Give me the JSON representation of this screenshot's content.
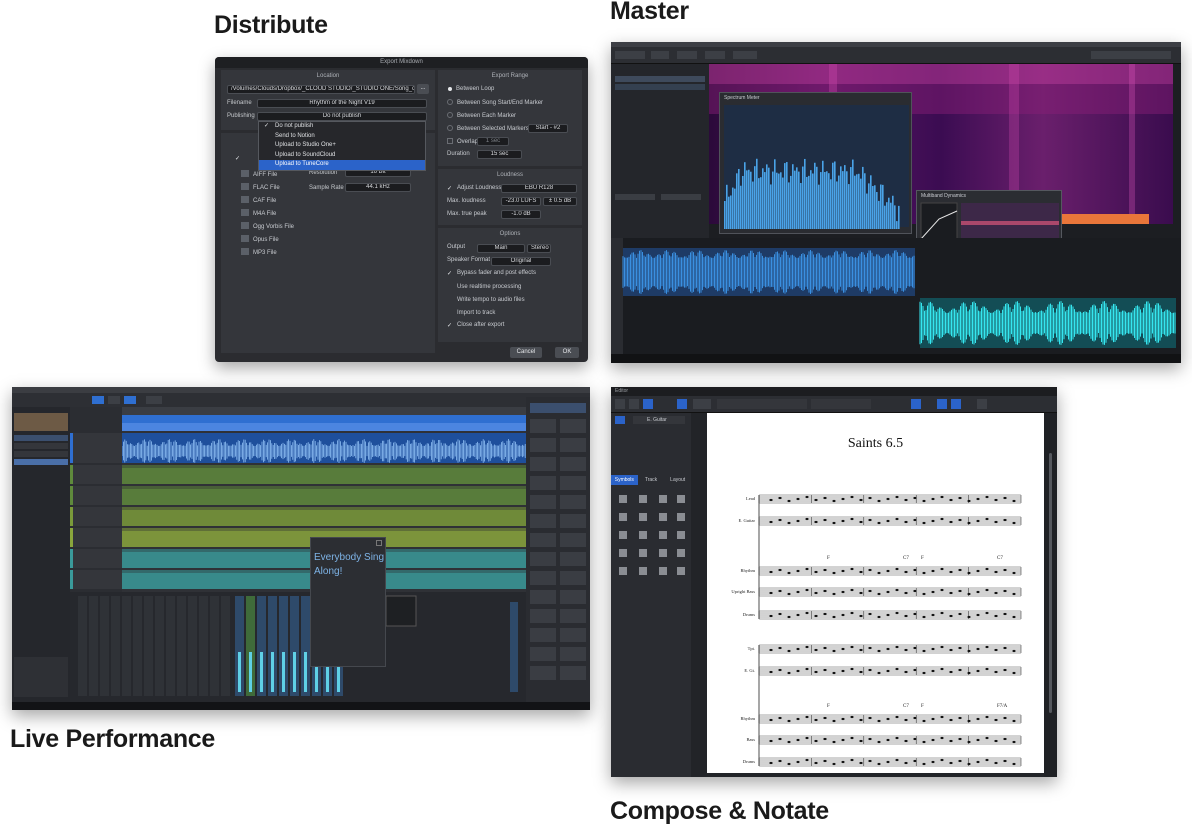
{
  "captions": {
    "distribute": "Distribute",
    "master": "Master",
    "live": "Live Performance",
    "compose": "Compose & Notate"
  },
  "export_mixdown": {
    "window_title": "Export Mixdown",
    "location_header": "Location",
    "path": "/Volumes/Clouds/Dropbox/_CLOUD STUDIO/_STUDIO ONE/Song_down",
    "path_button": "...",
    "filename_label": "Filename",
    "filename": "Rhythm of the Night V19",
    "publishing_label": "Publishing",
    "publishing_value": "Do not publish",
    "publish_options": [
      "Do not publish",
      "Send to Notion",
      "Upload to Studio One+",
      "Upload to SoundCloud",
      "Upload to TuneCore"
    ],
    "formats": [
      "AIFF File",
      "FLAC File",
      "CAF File",
      "M4A File",
      "Ogg Vorbis File",
      "Opus File",
      "MP3 File"
    ],
    "resolution_label": "Resolution",
    "resolution_value": "16 Bit",
    "samplerate_label": "Sample Rate",
    "samplerate_value": "44.1 kHz",
    "export_range_header": "Export Range",
    "range_options": [
      "Between Loop",
      "Between Song Start/End Marker",
      "Between Each Marker",
      "Between Selected Markers"
    ],
    "selected_marker_value": "Start - #2",
    "overlap_label": "Overlap",
    "overlap_value": "1 sec",
    "duration_label": "Duration",
    "duration_value": "15 sec",
    "loudness_header": "Loudness",
    "adjust_loudness_label": "Adjust Loudness",
    "adjust_loudness_value": "EBU R128",
    "max_loudness_label": "Max. loudness",
    "max_loudness_value": "-23.0 LUFS",
    "tolerance_value": "± 0.5 dB",
    "max_true_peak_label": "Max. true peak",
    "max_true_peak_value": "-1.0 dB",
    "options_header": "Options",
    "output_label": "Output",
    "output_value": "Main",
    "output_mode": "Stereo",
    "speaker_format_label": "Speaker Format",
    "speaker_format_value": "Original",
    "options": [
      {
        "label": "Bypass fader and post effects",
        "checked": true
      },
      {
        "label": "Use realtime processing",
        "checked": false
      },
      {
        "label": "Write tempo to audio files",
        "checked": false
      },
      {
        "label": "Import to track",
        "checked": false
      },
      {
        "label": "Close after export",
        "checked": true
      }
    ],
    "cancel_label": "Cancel",
    "ok_label": "OK"
  },
  "master": {
    "spectrum_window_title": "Spectrum Meter",
    "dynamics_window_title": "Multiband Dynamics",
    "colors": {
      "waveform_blue": "#3a8fe0",
      "waveform_cyan": "#35e6ef"
    }
  },
  "live": {
    "lyrics": "Everybody Sing Along!",
    "colors": {
      "lane_blue": "#2f6fd1",
      "lane_green": "#5f8a3c",
      "lane_teal": "#3a9a9a"
    }
  },
  "compose": {
    "window_title": "Editor",
    "instrument": "E. Guitar",
    "side_tabs": [
      "Symbols",
      "Track",
      "Layout"
    ],
    "score_title": "Saints 6.5",
    "system1_labels": [
      "Lead",
      "E. Guitar",
      "Rhythm",
      "Upright Bass",
      "Drums"
    ],
    "system2_labels": [
      "Tpt.",
      "E. Gt.",
      "Rhythm",
      "Bass",
      "Drums"
    ],
    "chords1": [
      "F",
      "C7",
      "F",
      "C7"
    ],
    "chords2": [
      "F",
      "C7",
      "F",
      "F7/A"
    ]
  }
}
